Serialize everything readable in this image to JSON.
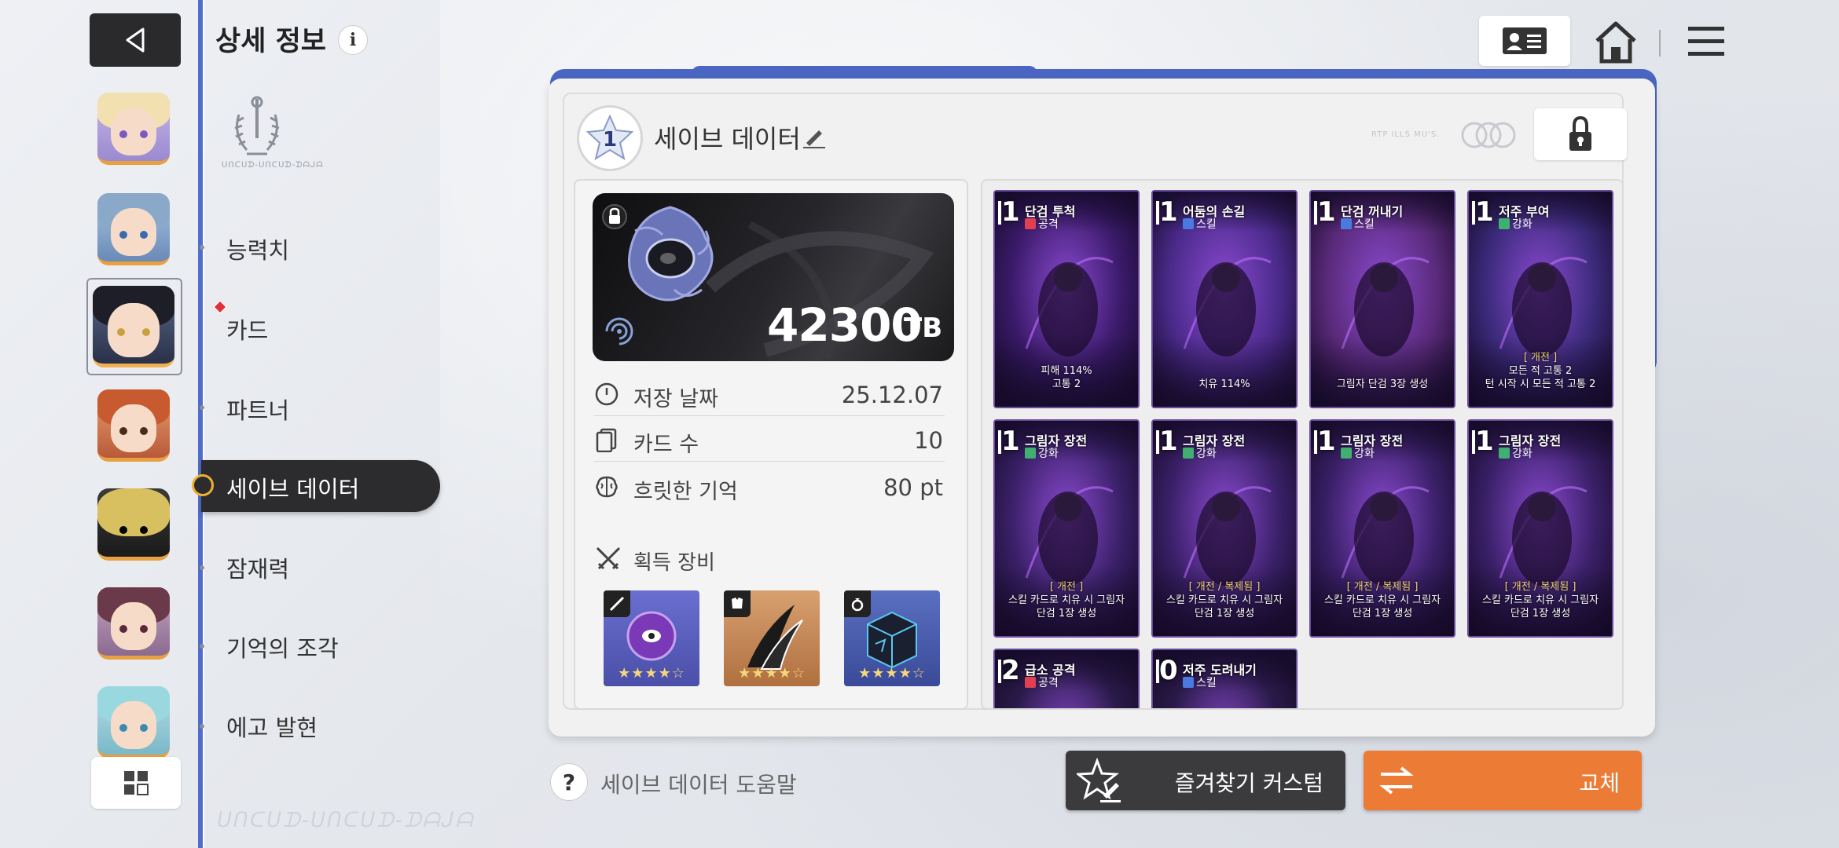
{
  "header": {
    "title": "상세 정보",
    "info_icon": "i",
    "emblem_caption": "ᑌᑎᑕᑌᗪ-ᑌᑎᑕᑌᗪ-ᗪᗩᒍᗩ"
  },
  "nav": {
    "items": [
      {
        "label": "능력치"
      },
      {
        "label": "카드"
      },
      {
        "label": "파트너"
      },
      {
        "label": "세이브 데이터"
      },
      {
        "label": "잠재력"
      },
      {
        "label": "기억의 조각"
      },
      {
        "label": "에고 발현"
      }
    ],
    "active_index": 3,
    "bottom_logo": "ᑌᑎᑕᑌᗪ-ᑌᑎᑕᑌᗪ-ᗪᗩᒍᗩ"
  },
  "save": {
    "rank": "1",
    "title": "세이브 데이터",
    "tiny_text": "RTP ILLS MU'S.",
    "score": "42300",
    "score_unit": "TB",
    "stats": [
      {
        "icon": "clock-icon",
        "label": "저장 날짜",
        "value": "25.12.07"
      },
      {
        "icon": "cards-icon",
        "label": "카드 수",
        "value": "10"
      },
      {
        "icon": "brain-icon",
        "label": "흐릿한 기억",
        "value": "80 pt"
      }
    ],
    "equipment_title": "획득 장비",
    "equipment": [
      {
        "tag": "sword-icon",
        "stars": 4,
        "max_stars": 5,
        "color": "#5a5fc0"
      },
      {
        "tag": "armor-icon",
        "stars": 4,
        "max_stars": 5,
        "color": "#c88a50"
      },
      {
        "tag": "ring-icon",
        "stars": 4,
        "max_stars": 5,
        "color": "#4a5ca8"
      }
    ]
  },
  "cards": [
    {
      "cost": "1",
      "name": "단검 투척",
      "type": "공격",
      "type_color": "#e04050",
      "desc": [
        "피해 114%",
        "고통 2"
      ],
      "art": "#3a1a6a"
    },
    {
      "cost": "1",
      "name": "어둠의 손길",
      "type": "스킬",
      "type_color": "#4a7ae0",
      "desc": [
        "치유 114%"
      ],
      "art": "#4a2a8a"
    },
    {
      "cost": "1",
      "name": "단검 꺼내기",
      "type": "스킬",
      "type_color": "#4a7ae0",
      "desc": [
        "그림자 단검 3장 생성"
      ],
      "art": "#5a2a7a"
    },
    {
      "cost": "1",
      "name": "저주 부여",
      "type": "강화",
      "type_color": "#40b070",
      "desc_tag": "[ 개전 ]",
      "desc": [
        "모든 적 고통 2",
        "턴 시작 시 모든 적 고통 2"
      ],
      "art": "#3a2a7a"
    },
    {
      "cost": "1",
      "name": "그림자 장전",
      "type": "강화",
      "type_color": "#40b070",
      "desc_tag": "[ 개전 ]",
      "desc": [
        "스킬 카드로 치유 시 그림자",
        "단검 1장 생성"
      ],
      "art": "#3a2068"
    },
    {
      "cost": "1",
      "name": "그림자 장전",
      "type": "강화",
      "type_color": "#40b070",
      "desc_tag": "[ 개전 / 복제됨 ]",
      "desc": [
        "스킬 카드로 치유 시 그림자",
        "단검 1장 생성"
      ],
      "art": "#3a2068"
    },
    {
      "cost": "1",
      "name": "그림자 장전",
      "type": "강화",
      "type_color": "#40b070",
      "desc_tag": "[ 개전 / 복제됨 ]",
      "desc": [
        "스킬 카드로 치유 시 그림자",
        "단검 1장 생성"
      ],
      "art": "#3a2068"
    },
    {
      "cost": "1",
      "name": "그림자 장전",
      "type": "강화",
      "type_color": "#40b070",
      "desc_tag": "[ 개전 / 복제됨 ]",
      "desc": [
        "스킬 카드로 치유 시 그림자",
        "단검 1장 생성"
      ],
      "art": "#3a2068"
    },
    {
      "cost": "2",
      "name": "급소 공격",
      "type": "공격",
      "type_color": "#e04050",
      "desc": [],
      "art": "#2a1a4a"
    },
    {
      "cost": "0",
      "name": "저주 도려내기",
      "type": "스킬",
      "type_color": "#4a7ae0",
      "desc": [],
      "art": "#2a1a4a"
    }
  ],
  "footer": {
    "help_icon": "?",
    "help_label": "세이브 데이터 도움말",
    "favorite_label": "즐겨찾기 커스텀",
    "swap_label": "교체"
  },
  "colors": {
    "accent_blue": "#4a66c2",
    "swap_orange": "#ec7b36",
    "dark_button": "#3b3b3e"
  }
}
